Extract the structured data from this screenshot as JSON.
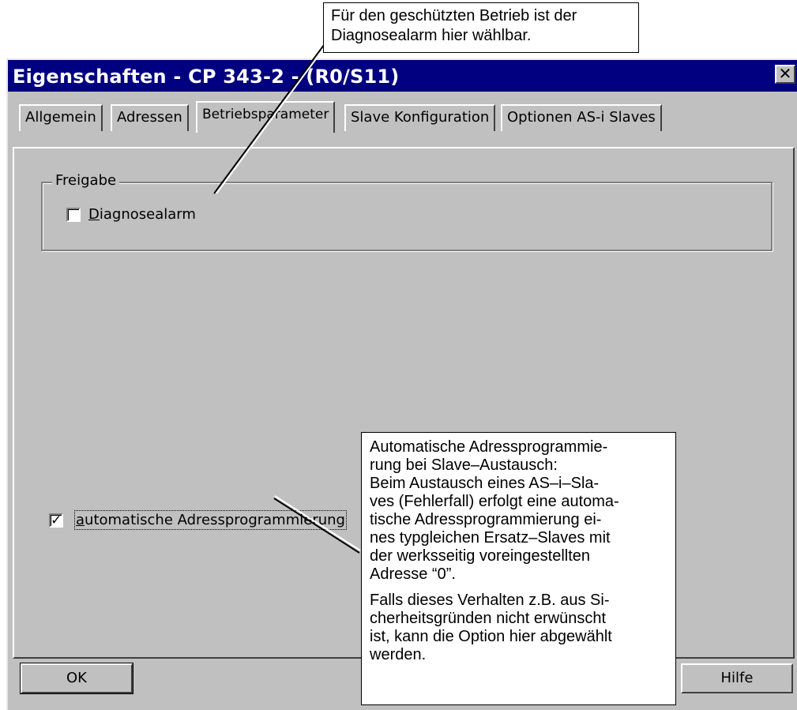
{
  "window": {
    "title": "Eigenschaften - CP 343-2 - (R0/S11)",
    "close_glyph": "✕"
  },
  "tabs": [
    {
      "label": "Allgemein"
    },
    {
      "label": "Adressen"
    },
    {
      "label": "Betriebsparameter",
      "active": true
    },
    {
      "label": "Slave Konfiguration"
    },
    {
      "label": "Optionen AS-i Slaves"
    }
  ],
  "panel": {
    "group_label": "Freigabe",
    "diagnose": {
      "label_first": "D",
      "label_rest": "iagnosealarm",
      "checked": false
    },
    "auto_addr": {
      "label_first": "a",
      "label_rest": "utomatische Adressprogrammierung",
      "checked": true,
      "check_glyph": "✓"
    }
  },
  "buttons": {
    "ok": "OK",
    "help": "Hilfe"
  },
  "callout_top": {
    "lines": [
      "Für den geschützten Betrieb ist der",
      "Diagnosealarm hier wählbar."
    ]
  },
  "callout_bottom": {
    "para1": [
      "Automatische Adressprogrammie-",
      "rung bei Slave–Austausch:",
      "Beim Austausch eines AS–i–Sla-",
      "ves (Fehlerfall) erfolgt eine automa-",
      "tische Adressprogrammierung ei-",
      "nes typgleichen Ersatz–Slaves mit",
      "der werksseitig voreingestellten",
      "Adresse “0”."
    ],
    "para2": [
      "Falls dieses Verhalten z.B. aus Si-",
      "cherheitsgründen nicht erwünscht",
      "ist, kann die Option hier abgewählt",
      "werden."
    ]
  }
}
